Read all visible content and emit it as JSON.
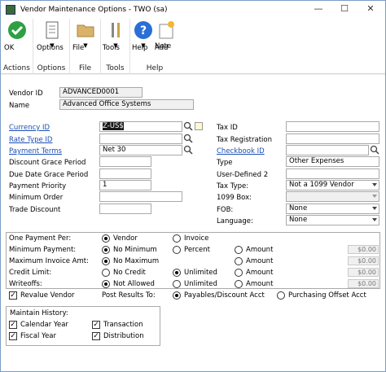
{
  "window": {
    "title": "Vendor Maintenance Options  -  TWO (sa)",
    "controls": {
      "minimize": "—",
      "maximize": "☐",
      "close": "✕"
    }
  },
  "ribbon": {
    "ok": "OK",
    "actions_group": "Actions",
    "options": "Options",
    "options_group": "Options",
    "file": "File",
    "file_group": "File",
    "tools": "Tools",
    "tools_group": "Tools",
    "help": "Help",
    "add_note_1": "Add",
    "add_note_2": "Note",
    "help_group": "Help"
  },
  "form": {
    "vendor_id_label": "Vendor ID",
    "vendor_id": "ADVANCED0001",
    "name_label": "Name",
    "name": "Advanced Office Systems",
    "currency_id_label": "Currency ID",
    "currency_id": "Z-US$",
    "rate_type_id_label": "Rate Type ID",
    "rate_type_id": "",
    "payment_terms_label": "Payment Terms",
    "payment_terms": "Net 30",
    "discount_grace_label": "Discount Grace Period",
    "discount_grace": "",
    "due_date_grace_label": "Due Date Grace Period",
    "due_date_grace": "",
    "payment_priority_label": "Payment Priority",
    "payment_priority": "1",
    "minimum_order_label": "Minimum Order",
    "minimum_order": "",
    "trade_discount_label": "Trade Discount",
    "trade_discount": "",
    "tax_id_label": "Tax ID",
    "tax_id": "",
    "tax_registration_label": "Tax Registration",
    "tax_registration": "",
    "checkbook_id_label": "Checkbook ID",
    "checkbook_id": "",
    "type_label": "Type",
    "type": "Other Expenses",
    "user_defined_label": "User-Defined 2",
    "user_defined": "",
    "tax_type_label": "Tax Type:",
    "tax_type": "Not a 1099 Vendor",
    "box_1099_label": "1099 Box:",
    "box_1099": "",
    "fob_label": "FOB:",
    "fob": "None",
    "language_label": "Language:",
    "language": "None"
  },
  "payment_section": {
    "one_payment_per_label": "One Payment Per:",
    "vendor": "Vendor",
    "invoice": "Invoice",
    "minimum_payment_label": "Minimum Payment:",
    "no_minimum": "No Minimum",
    "percent": "Percent",
    "amount": "Amount",
    "maximum_invoice_label": "Maximum Invoice Amt:",
    "no_maximum": "No Maximum",
    "credit_limit_label": "Credit Limit:",
    "no_credit": "No Credit",
    "unlimited": "Unlimited",
    "writeoffs_label": "Writeoffs:",
    "not_allowed": "Not Allowed",
    "zero": "$0.00",
    "revalue_vendor": "Revalue Vendor",
    "post_results_label": "Post Results To:",
    "payables_discount": "Payables/Discount Acct",
    "purchasing_offset": "Purchasing Offset Acct"
  },
  "history": {
    "title": "Maintain History:",
    "calendar_year": "Calendar Year",
    "fiscal_year": "Fiscal Year",
    "transaction": "Transaction",
    "distribution": "Distribution"
  },
  "colors": {
    "link": "#1a4fb5",
    "ok_green": "#2ea043",
    "help_blue": "#2a6fd6"
  }
}
